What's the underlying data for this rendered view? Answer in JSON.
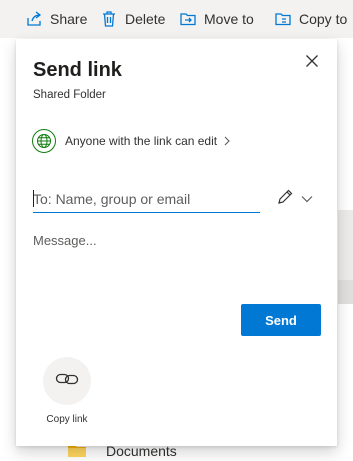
{
  "command_bar": {
    "share_label": "Share",
    "delete_label": "Delete",
    "move_label": "Move to",
    "copy_label": "Copy to"
  },
  "background": {
    "folder_name": "Documents"
  },
  "dialog": {
    "title": "Send link",
    "subtitle": "Shared Folder",
    "permission_label": "Anyone with the link can edit",
    "to_placeholder": "To: Name, group or email",
    "message_placeholder": "Message...",
    "send_label": "Send",
    "copy_link_label": "Copy link"
  },
  "colors": {
    "accent": "#0078d4",
    "globe": "#107c10",
    "command_bar_bg": "#f3f2f1",
    "folder": "#ffb900"
  },
  "icons": [
    "share-icon",
    "delete-icon",
    "move-icon",
    "copy-icon",
    "close-icon",
    "globe-icon",
    "chevron-right-icon",
    "pencil-icon",
    "chevron-down-icon",
    "link-icon",
    "folder-icon"
  ]
}
